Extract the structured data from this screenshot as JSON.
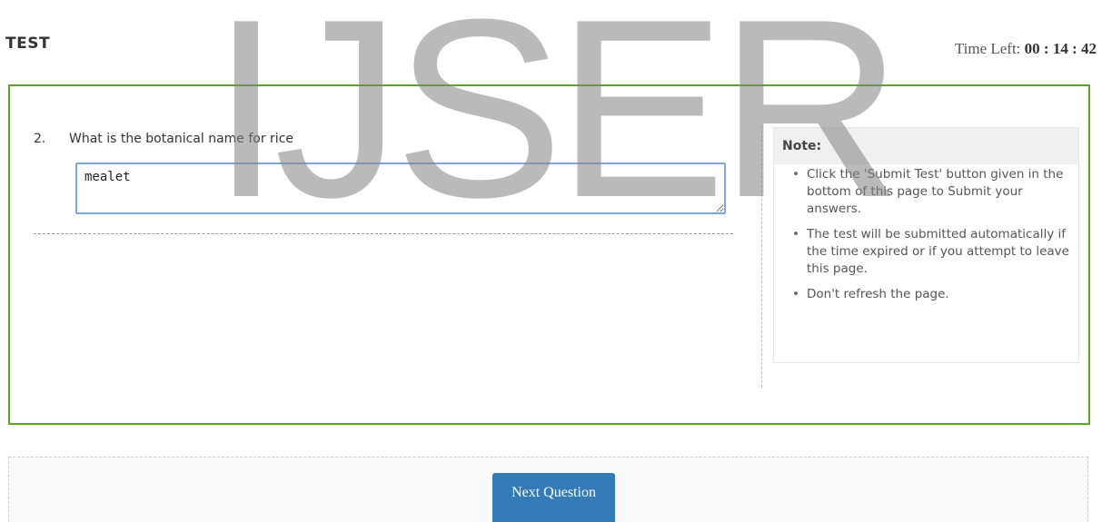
{
  "header": {
    "title": "TEST",
    "timer_label": "Time Left: ",
    "timer_value": "00 : 14 : 42"
  },
  "question": {
    "number": "2.",
    "text": "What is the botanical name for rice",
    "answer_value": "mealet"
  },
  "note": {
    "title": "Note:",
    "items": [
      "Click the 'Submit Test' button given in the bottom of this page to Submit your answers.",
      "The test will be submitted automatically if the time expired or if you attempt to leave this page.",
      "Don't refresh the page."
    ]
  },
  "footer": {
    "next_label": "Next Question"
  },
  "watermark": {
    "text": "IJSER"
  },
  "colors": {
    "question_border": "#5ea527",
    "button_bg": "#337ab7",
    "input_border": "#7ea6e0"
  }
}
